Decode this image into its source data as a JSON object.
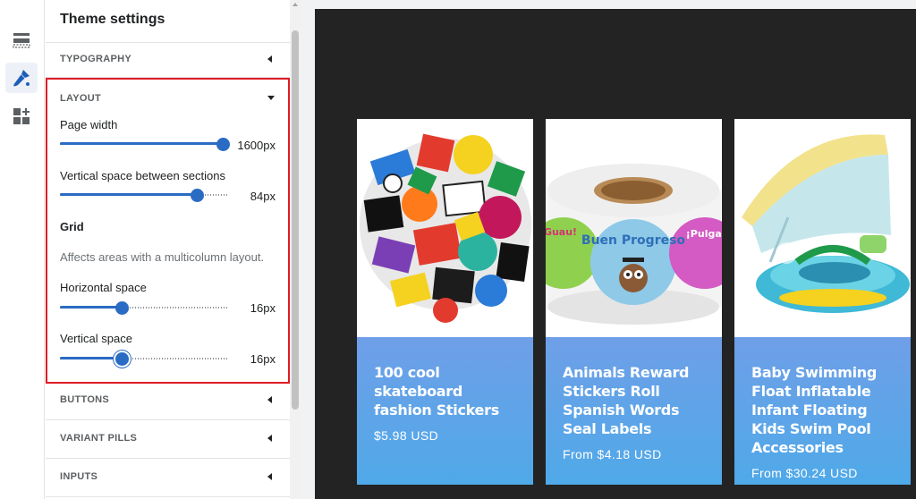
{
  "panel": {
    "title": "Theme settings",
    "sections": {
      "typography": "TYPOGRAPHY",
      "layout": "LAYOUT",
      "buttons": "BUTTONS",
      "variant_pills": "VARIANT PILLS",
      "inputs": "INPUTS"
    },
    "layout": {
      "page_width": {
        "label": "Page width",
        "value": "1600px",
        "fraction": 1.0
      },
      "vertical_space_sections": {
        "label": "Vertical space between sections",
        "value": "84px",
        "fraction": 0.84
      },
      "grid_heading": "Grid",
      "grid_help": "Affects areas with a multicolumn layout.",
      "horizontal_space": {
        "label": "Horizontal space",
        "value": "16px",
        "fraction": 0.38
      },
      "vertical_space": {
        "label": "Vertical space",
        "value": "16px",
        "fraction": 0.38
      }
    }
  },
  "rail": {
    "icons": [
      "sections-icon",
      "theme-settings-brush-icon",
      "app-embeds-icon"
    ]
  },
  "preview": {
    "products": [
      {
        "title": "100 cool skateboard fashion Stickers",
        "price": "$5.98 USD"
      },
      {
        "title": "Animals Reward Stickers Roll Spanish Words Seal Labels",
        "price": "From $4.18 USD"
      },
      {
        "title": "Baby Swimming Float Inflatable Infant Floating Kids Swim Pool Accessories",
        "price": "From $30.24 USD"
      }
    ],
    "sticker_roll_text": {
      "bueno": "Buen Progreso",
      "left": "¡Guau!",
      "right": "¡Pulgar!"
    }
  },
  "colors": {
    "accent": "#2a6bc4",
    "highlight_border": "#e01b24",
    "preview_background": "#232323",
    "card_info_gradient": [
      "#6f9fe8",
      "#4fa9e8"
    ]
  }
}
